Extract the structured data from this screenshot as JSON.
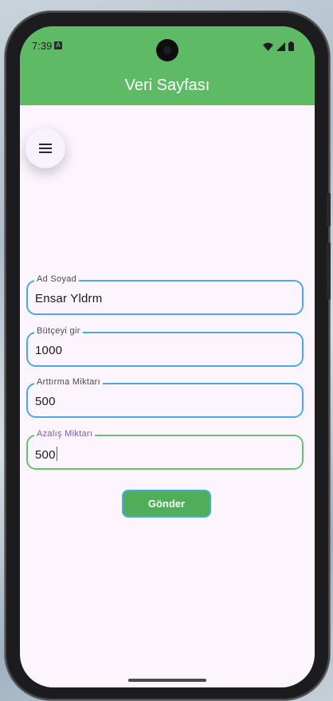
{
  "status_bar": {
    "time": "7:39",
    "notification_letter": "A"
  },
  "app_bar": {
    "title": "Veri Sayfası"
  },
  "menu_button": {
    "icon": "menu-icon"
  },
  "form": {
    "fields": [
      {
        "label": "Ad Soyad",
        "value": "Ensar Yldrm"
      },
      {
        "label": "Bütçeyi gir",
        "value": "1000"
      },
      {
        "label": "Arttırma Miktarı",
        "value": "500"
      },
      {
        "label": "Azalış Miktarı",
        "value": "500"
      }
    ],
    "submit_label": "Gönder"
  },
  "colors": {
    "app_bar": "#5fba66",
    "field_border": "#4ea6e6",
    "focused_border": "#66c36c",
    "button": "#4fae57",
    "background": "#fcf5fd"
  }
}
